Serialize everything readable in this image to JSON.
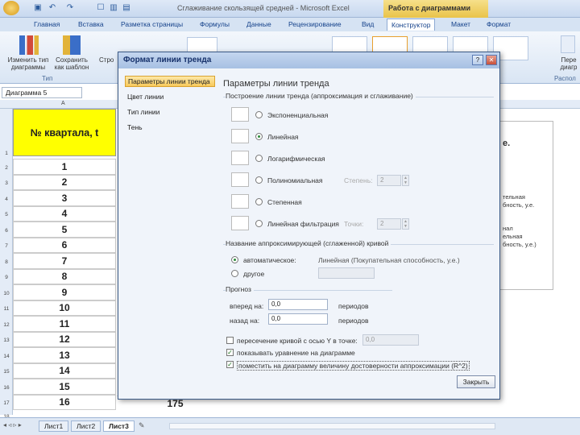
{
  "window": {
    "title": "Сглаживание скользящей средней - Microsoft Excel",
    "context_title": "Работа с диаграммами"
  },
  "ribbon_tabs": [
    "Главная",
    "Вставка",
    "Разметка страницы",
    "Формулы",
    "Данные",
    "Рецензирование",
    "Вид",
    "Конструктор",
    "Макет",
    "Формат"
  ],
  "ribbon": {
    "change_type": "Изменить тип диаграммы",
    "save_template": "Сохранить как шаблон",
    "str": "Стро",
    "group_label": "Тип",
    "right_label": "Пере диагр",
    "right_group": "Распол"
  },
  "namebox": "Диаграмма 5",
  "columns": [
    "A"
  ],
  "rows": [
    "1",
    "2",
    "3",
    "4",
    "5",
    "6",
    "7",
    "8",
    "9",
    "10",
    "11",
    "12",
    "13",
    "14",
    "15",
    "16",
    "17",
    "18",
    "19"
  ],
  "table": {
    "header": "№ квартала, t",
    "values": [
      "1",
      "2",
      "3",
      "4",
      "5",
      "6",
      "7",
      "8",
      "9",
      "10",
      "11",
      "12",
      "13",
      "14",
      "15",
      "16"
    ],
    "last_value": "175"
  },
  "chart_fragments": [
    "е.",
    "тельная",
    "бность, у.е.",
    "нал",
    "ельная",
    "бность, у.е.)"
  ],
  "sheets": [
    "Лист1",
    "Лист2",
    "Лист3"
  ],
  "dialog": {
    "title": "Формат линии тренда",
    "nav": [
      "Параметры линии тренда",
      "Цвет линии",
      "Тип линии",
      "Тень"
    ],
    "panel_title": "Параметры линии тренда",
    "section_build": "Построение линии тренда (аппроксимация и сглаживание)",
    "types": [
      {
        "label": "Экспоненциальная",
        "icon": "exp-trend-icon"
      },
      {
        "label": "Линейная",
        "icon": "linear-trend-icon"
      },
      {
        "label": "Логарифмическая",
        "icon": "log-trend-icon"
      },
      {
        "label": "Полиномиальная",
        "icon": "poly-trend-icon"
      },
      {
        "label": "Степенная",
        "icon": "power-trend-icon"
      },
      {
        "label": "Линейная фильтрация",
        "icon": "moving-average-icon"
      }
    ],
    "selected_type": "Линейная",
    "degree_label": "Степень:",
    "degree_value": "2",
    "points_label": "Точки:",
    "points_value": "2",
    "section_name": "Название аппроксимирующей (сглаженной) кривой",
    "auto_label": "автоматическое:",
    "auto_value": "Линейная (Покупательная способность, у.е.)",
    "other_label": "другое",
    "section_forecast": "Прогноз",
    "forward_label": "вперед на:",
    "forward_value": "0,0",
    "periods": "периодов",
    "back_label": "назад на:",
    "back_value": "0,0",
    "intercept_label": "пересечение кривой с осью Y в точке:",
    "intercept_value": "0,0",
    "show_equation": "показывать уравнение на диаграмме",
    "show_r2": "поместить на диаграмму величину достоверности аппроксимации (R^2)",
    "close": "Закрыть"
  }
}
